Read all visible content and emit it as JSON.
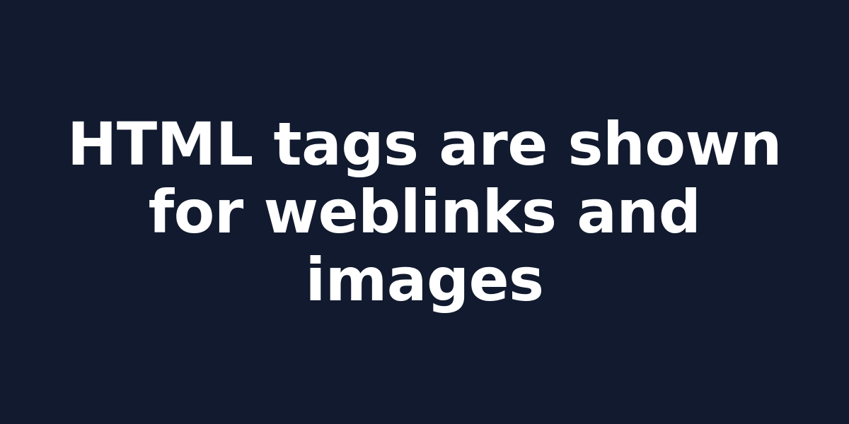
{
  "headline": "HTML tags are shown for weblinks and images",
  "colors": {
    "background": "#111a2e",
    "text": "#ffffff"
  }
}
